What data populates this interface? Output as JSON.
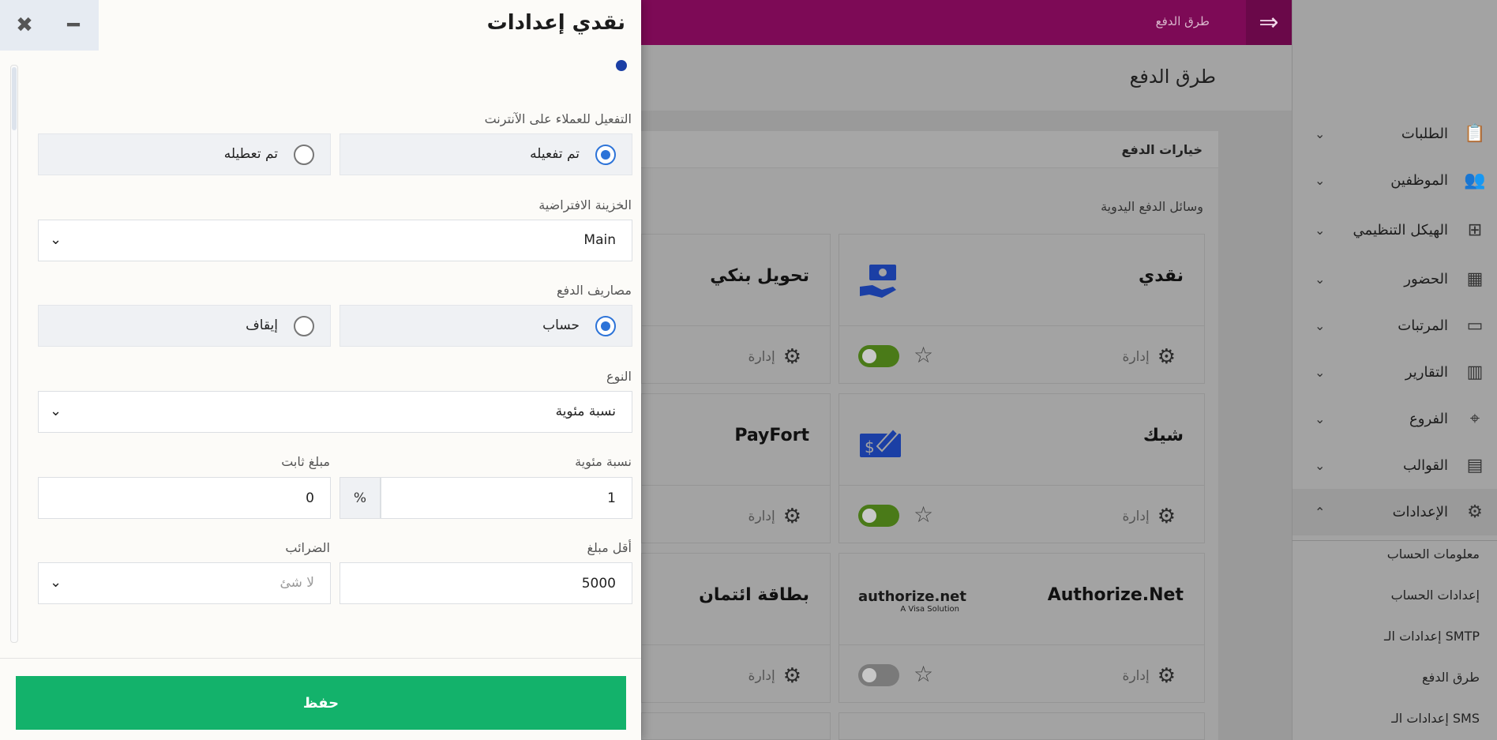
{
  "topbar": {
    "breadcrumb": "طرق الدفع",
    "menu_icon": "arrow-right-icon"
  },
  "page": {
    "title": "طرق الدفع"
  },
  "panel": {
    "title": "خيارات الدفع",
    "section": "وسائل الدفع اليدوية"
  },
  "cards": [
    {
      "name": "نقدي",
      "manage": "إدارة",
      "enabled": true
    },
    {
      "name": "تحويل بنكي",
      "manage": "إدارة"
    },
    {
      "name": "شيك",
      "manage": "إدارة",
      "enabled": true
    },
    {
      "name": "PayFort",
      "manage": "إدارة"
    },
    {
      "name": "Authorize.Net",
      "manage": "إدارة",
      "enabled": false,
      "logo_text": "authorize.net",
      "logo_sub": "A Visa Solution"
    },
    {
      "name": "بطاقة ائتمان",
      "manage": "إدارة"
    }
  ],
  "sidebar": {
    "items": [
      {
        "label": "الطلبات",
        "icon": "clipboard-icon"
      },
      {
        "label": "الموظفين",
        "icon": "users-icon"
      },
      {
        "label": "الهيكل التنظيمي",
        "icon": "hierarchy-icon"
      },
      {
        "label": "الحضور",
        "icon": "calendar-icon"
      },
      {
        "label": "المرتبات",
        "icon": "money-icon"
      },
      {
        "label": "التقارير",
        "icon": "bar-chart-icon"
      },
      {
        "label": "الفروع",
        "icon": "location-pin-icon"
      },
      {
        "label": "القوالب",
        "icon": "document-icon"
      },
      {
        "label": "الإعدادات",
        "icon": "gear-icon"
      }
    ],
    "subitems": [
      "معلومات الحساب",
      "إعدادات الحساب",
      "إعدادات الـ SMTP",
      "طرق الدفع",
      "إعدادات الـ SMS"
    ]
  },
  "drawer": {
    "title": "نقدي إعدادات",
    "online_activation": {
      "label": "التفعيل للعملاء على الآنترنت",
      "options": [
        "تم تفعيله",
        "تم تعطيله"
      ],
      "selected": 0
    },
    "default_treasury": {
      "label": "الخزينة الافتراضية",
      "value": "Main"
    },
    "payment_fees": {
      "label": "مصاريف الدفع",
      "options": [
        "حساب",
        "إيقاف"
      ],
      "selected": 0
    },
    "type": {
      "label": "النوع",
      "value": "نسبة مئوية"
    },
    "percentage": {
      "label": "نسبة مئوية",
      "value": "1",
      "suffix": "%"
    },
    "fixed_amount": {
      "label": "مبلغ ثابت",
      "value": "0"
    },
    "min_amount": {
      "label": "أقل مبلغ",
      "value": "5000"
    },
    "taxes": {
      "label": "الضرائب",
      "placeholder": "لا شئ"
    },
    "save_label": "حفظ"
  }
}
